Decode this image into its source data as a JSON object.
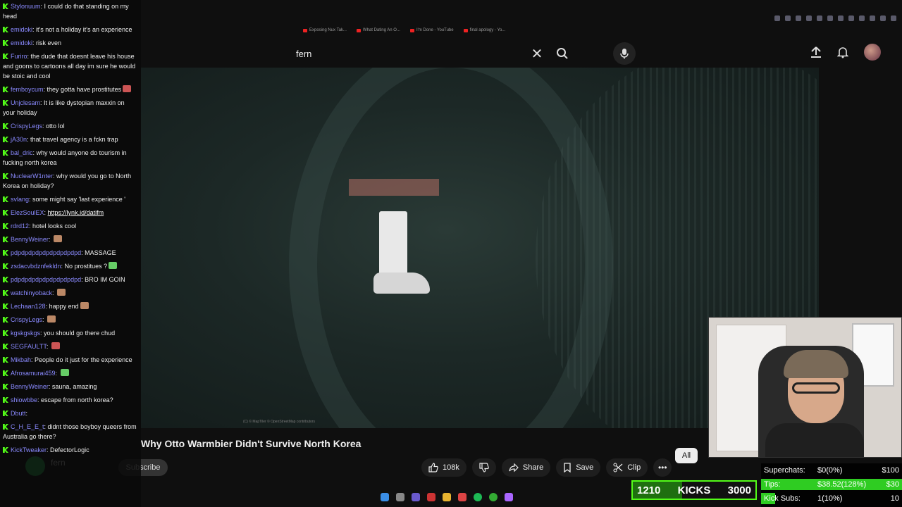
{
  "browser": {
    "bookmarks": [
      "Exposing Nux Tak...",
      "What Dating An O...",
      "I'm Done - YouTube",
      "final apology - Yo..."
    ]
  },
  "search": {
    "query": "fern"
  },
  "video": {
    "title": "Why Otto Warmbier Didn't Survive North Korea",
    "map_credit": "(C) © MapTiler © OpenStreetMap contributors"
  },
  "channel": {
    "name": "fern",
    "subscribe_label": "Subscribe"
  },
  "actions": {
    "likes": "108k",
    "share": "Share",
    "save": "Save",
    "clip": "Clip",
    "more": "•••"
  },
  "filter_chip": "All",
  "chat": [
    {
      "user": "Stylonuum",
      "text": "I could do that standing on my head"
    },
    {
      "user": "emidoki",
      "text": "it's not a holiday it's an experience"
    },
    {
      "user": "emidoki",
      "text": "risk even"
    },
    {
      "user": "Furiro",
      "text": "the dude that doesnt leave his house and goons to cartoons all day im sure he would be stoic and cool"
    },
    {
      "user": "femboycum",
      "text": "they gotta have prostitutes",
      "emote": "e-red"
    },
    {
      "user": "Unjclesam",
      "text": "It is like dystopian maxxin on your holiday"
    },
    {
      "user": "CrispyLegs",
      "text": "otto lol"
    },
    {
      "user": "jA30n",
      "text": "that travel agency is a fckn trap"
    },
    {
      "user": "bal_dric",
      "text": "why would anyone do tourism in fucking north korea"
    },
    {
      "user": "NuclearW1nter",
      "text": "why would you go to North Korea on holiday?"
    },
    {
      "user": "svlang",
      "text": "some might say 'last experience '"
    },
    {
      "user": "ElezSoulEX",
      "text": "https://lynk.id/datifm",
      "link": true
    },
    {
      "user": "rdrd12",
      "text": "hotel looks cool"
    },
    {
      "user": "BennyWeiner",
      "text": "",
      "emote": "e-face"
    },
    {
      "user": "pdpdpdpdpdpdpdpdpdpd",
      "text": "MASSAGE"
    },
    {
      "user": "zsdacvbdznfekldn",
      "text": "No prostitues ?",
      "emote": "e-green"
    },
    {
      "user": "pdpdpdpdpdpdpdpdpdpd",
      "text": "BRO IM GOIN"
    },
    {
      "user": "watchinyoback",
      "text": "",
      "emote": "e-face"
    },
    {
      "user": "Lechaan128",
      "text": "happy end",
      "emote": "e-face"
    },
    {
      "user": "CrispyLegs",
      "text": "",
      "emote": "e-face"
    },
    {
      "user": "kgskgskgs",
      "text": "you should go there chud"
    },
    {
      "user": "SEGFAULTT",
      "text": "",
      "emote": "e-red"
    },
    {
      "user": "Mikbah",
      "text": "People do it just for the experience"
    },
    {
      "user": "Afrosamurai459",
      "text": "",
      "emote": "e-green"
    },
    {
      "user": "BennyWeiner",
      "text": "sauna, amazing"
    },
    {
      "user": "shiowbbe",
      "text": "escape from north korea?"
    },
    {
      "user": "Dbutt",
      "text": ""
    },
    {
      "user": "C_H_E_E_t",
      "text": "didnt those boyboy queers from Australia go there?"
    },
    {
      "user": "KickTweaker",
      "text": "DefectorLogic"
    }
  ],
  "kicks": {
    "current": "1210",
    "label": "KICKS",
    "target": "3000",
    "progress": 0.4
  },
  "goals": [
    {
      "label": "Superchats:",
      "value": "$0(0%)",
      "target": "$100",
      "progress": 0
    },
    {
      "label": "Tips:",
      "value": "$38.52(128%)",
      "target": "$30",
      "progress": 1
    },
    {
      "label": "Kick Subs:",
      "value": "1(10%)",
      "target": "10",
      "progress": 0.1
    }
  ],
  "colors": {
    "kick_green": "#53fc18",
    "chat_user": "#8a8aff",
    "goal_fill": "#2fcc22"
  }
}
